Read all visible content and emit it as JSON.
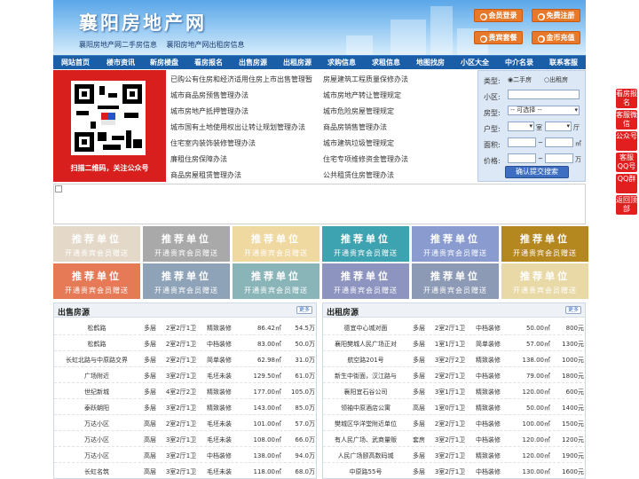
{
  "site": {
    "logo": "襄阳房地产网",
    "sub_links": [
      "襄阳房地产网二手房信息",
      "襄阳房地产网出租房信息"
    ]
  },
  "header_buttons": [
    "会员登录",
    "免费注册",
    "贵宾套餐",
    "金币充值"
  ],
  "nav": [
    "网站首页",
    "楼市资讯",
    "新房楼盘",
    "看房报名",
    "出售房源",
    "出租房源",
    "求购信息",
    "求租信息",
    "地图找房",
    "小区大全",
    "中介名录",
    "联系客服"
  ],
  "qr": {
    "caption": "扫描二维码，关注公众号"
  },
  "links": [
    "已购公有住房和经济适用住房上市出售管理暂",
    "房屋建筑工程质量保修办法",
    "城市商品房预售管理办法",
    "城市房地产转让管理规定",
    "城市房地产抵押管理办法",
    "城市危险房屋管理规定",
    "城市国有土地使用权出让转让规划管理办法",
    "商品房销售管理办法",
    "住宅室内装饰装修管理办法",
    "城市建筑垃圾管理规定",
    "廉租住房保障办法",
    "住宅专项维修资金管理办法",
    "商品房屋租赁管理办法",
    "公共租赁住房管理办法"
  ],
  "search": {
    "type_label": "类型:",
    "opt_sale": "二手房",
    "opt_rent": "出租房",
    "community_label": "小区:",
    "style_label": "房型:",
    "style_select": "-- 可选择 --",
    "layout_label": "户型:",
    "room_unit": "室",
    "hall_unit": "厅",
    "area_label": "面积:",
    "area_to": "~",
    "area_unit": "㎡",
    "price_label": "价格:",
    "price_to": "~",
    "price_unit": "万",
    "submit": "确认提交搜索"
  },
  "promo": {
    "title": "推荐单位",
    "sub": "开通贵宾会员赠送",
    "colors": [
      "#e4d9c8",
      "#a9a9a9",
      "#efd9a0",
      "#3ea3b0",
      "#8a9bd0",
      "#b5871f",
      "#e67a57",
      "#8fa3b8",
      "#89b4b8",
      "#8d94bf",
      "#8c9ab5",
      "#e8d9a7"
    ]
  },
  "sale_panel": {
    "title": "出售房源",
    "more": "更多",
    "rows": [
      [
        "松鹤路",
        "多层",
        "2室2厅1卫",
        "精致装修",
        "86.42㎡",
        "54.5万"
      ],
      [
        "松鹤路",
        "多层",
        "2室2厅1卫",
        "中档装修",
        "83.00㎡",
        "50.0万"
      ],
      [
        "长虹北路与中原路交界",
        "多层",
        "2室2厅1卫",
        "简单装修",
        "62.98㎡",
        "31.0万"
      ],
      [
        "广场附近",
        "多层",
        "3室2厅1卫",
        "毛坯未装",
        "129.50㎡",
        "61.0万"
      ],
      [
        "世纪新城",
        "多层",
        "4室2厅2卫",
        "精致装修",
        "177.00㎡",
        "105.0万"
      ],
      [
        "泰跃朝阳",
        "多层",
        "3室2厅1卫",
        "精致装修",
        "143.00㎡",
        "85.0万"
      ],
      [
        "万达小区",
        "高层",
        "2室2厅1卫",
        "毛坯未装",
        "101.00㎡",
        "57.0万"
      ],
      [
        "万达小区",
        "高层",
        "3室2厅1卫",
        "毛坯未装",
        "108.00㎡",
        "66.0万"
      ],
      [
        "万达小区",
        "高层",
        "3室2厅1卫",
        "中档装修",
        "138.00㎡",
        "94.0万"
      ],
      [
        "长虹名筑",
        "高层",
        "3室2厅1卫",
        "毛坯未装",
        "118.00㎡",
        "68.0万"
      ]
    ]
  },
  "rent_panel": {
    "title": "出租房源",
    "more": "更多",
    "rows": [
      [
        "德宜中心城对面",
        "多层",
        "2室2厅1卫",
        "中档装修",
        "50.00㎡",
        "800元"
      ],
      [
        "襄阳樊城人民广场正对",
        "多层",
        "1室1厅1卫",
        "简单装修",
        "57.00㎡",
        "1300元"
      ],
      [
        "航空路201号",
        "多层",
        "3室2厅2卫",
        "精致装修",
        "138.00㎡",
        "1000元"
      ],
      [
        "新生中街面，汉江路与",
        "多层",
        "2室2厅1卫",
        "中档装修",
        "79.00㎡",
        "1800元"
      ],
      [
        "襄阳宜石谷公司",
        "多层",
        "3室1厅1卫",
        "精致装修",
        "120.00㎡",
        "600元"
      ],
      [
        "领袖中原酒店公寓",
        "高层",
        "1室0厅1卫",
        "精致装修",
        "50.00㎡",
        "1400元"
      ],
      [
        "樊城区华洋堂附近单位",
        "多层",
        "2室2厅1卫",
        "中档装修",
        "100.00㎡",
        "1500元"
      ],
      [
        "有人民广场、武商量贩",
        "套房",
        "3室2厅1卫",
        "中档装修",
        "120.00㎡",
        "1200元"
      ],
      [
        "人民广场颐高数码城",
        "多层",
        "3室2厅1卫",
        "精致装修",
        "120.00㎡",
        "1900元"
      ],
      [
        "中原路55号",
        "多层",
        "3室2厅1卫",
        "中档装修",
        "130.00㎡",
        "1600元"
      ]
    ]
  },
  "float_bar": [
    "看房报名",
    "客服微信",
    "公众号",
    "客服QQ号",
    "QQ群",
    "返回顶部"
  ]
}
